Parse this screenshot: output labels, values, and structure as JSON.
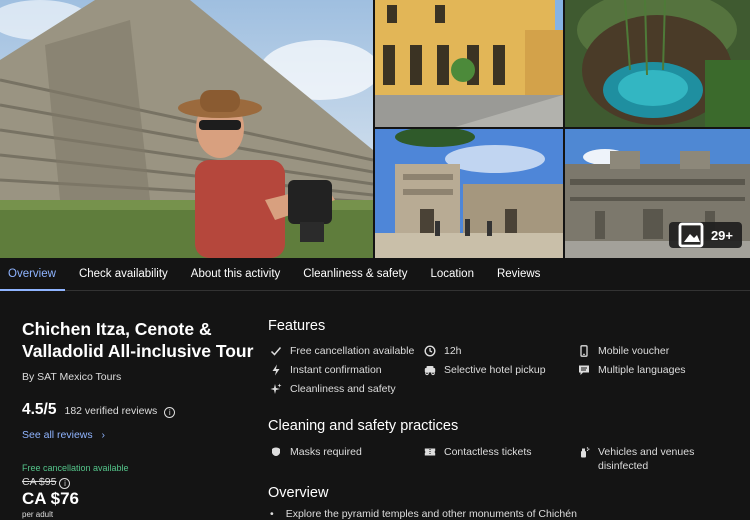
{
  "gallery": {
    "more_count": "29+"
  },
  "tabs": [
    {
      "label": "Overview",
      "active": true
    },
    {
      "label": "Check availability",
      "active": false
    },
    {
      "label": "About this activity",
      "active": false
    },
    {
      "label": "Cleanliness & safety",
      "active": false
    },
    {
      "label": "Location",
      "active": false
    },
    {
      "label": "Reviews",
      "active": false
    }
  ],
  "activity": {
    "title": "Chichen Itza, Cenote & Valladolid All-inclusive Tour",
    "operator": "By SAT Mexico Tours",
    "rating": "4.5/5",
    "reviews": "182 verified reviews",
    "see_all": "See all reviews",
    "free_cancellation": "Free cancellation available",
    "old_price": "CA $95",
    "price": "CA $76",
    "per": "per adult"
  },
  "features": {
    "title": "Features",
    "items": [
      {
        "label": "Free cancellation available",
        "icon": "check-icon"
      },
      {
        "label": "12h",
        "icon": "clock-icon"
      },
      {
        "label": "Mobile voucher",
        "icon": "phone-icon"
      },
      {
        "label": "Instant confirmation",
        "icon": "bolt-icon"
      },
      {
        "label": "Selective hotel pickup",
        "icon": "car-icon"
      },
      {
        "label": "Multiple languages",
        "icon": "chat-icon"
      },
      {
        "label": "Cleanliness and safety",
        "icon": "sparkle-icon"
      }
    ]
  },
  "cleaning": {
    "title": "Cleaning and safety practices",
    "items": [
      {
        "label": "Masks required",
        "icon": "mask-icon"
      },
      {
        "label": "Contactless tickets",
        "icon": "ticket-icon"
      },
      {
        "label": "Vehicles and venues disinfected",
        "icon": "spray-icon"
      }
    ]
  },
  "overview": {
    "title": "Overview",
    "bullet": "Explore the pyramid temples and other monuments of Chichén"
  },
  "colors": {
    "background": "#141414",
    "accent": "#8fb4ff",
    "success": "#54c48a"
  }
}
